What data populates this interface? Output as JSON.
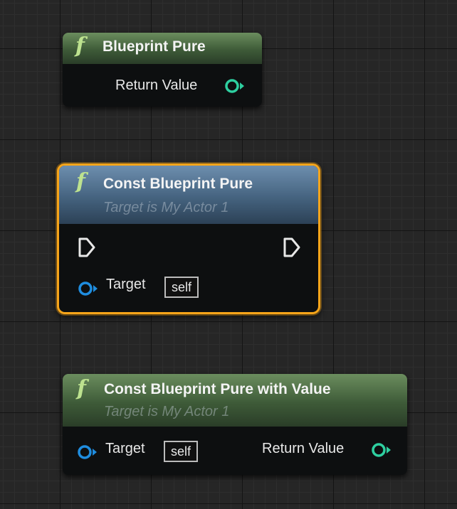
{
  "nodes": {
    "blueprint_pure": {
      "title": "Blueprint Pure",
      "return_label": "Return Value"
    },
    "const_blueprint_pure": {
      "title": "Const Blueprint Pure",
      "subtitle": "Target is My Actor 1",
      "target_label": "Target",
      "target_default": "self"
    },
    "const_blueprint_pure_value": {
      "title": "Const Blueprint Pure with Value",
      "subtitle": "Target is My Actor 1",
      "target_label": "Target",
      "target_default": "self",
      "return_label": "Return Value"
    }
  },
  "icons": {
    "function": "f"
  },
  "colors": {
    "selection": "#f7a51a",
    "header_pure": "#3e5b38",
    "header_impure": "#45637f",
    "pin_green": "#2ecfa0",
    "pin_blue": "#1f8ddf",
    "function_icon": "#bde28f"
  }
}
